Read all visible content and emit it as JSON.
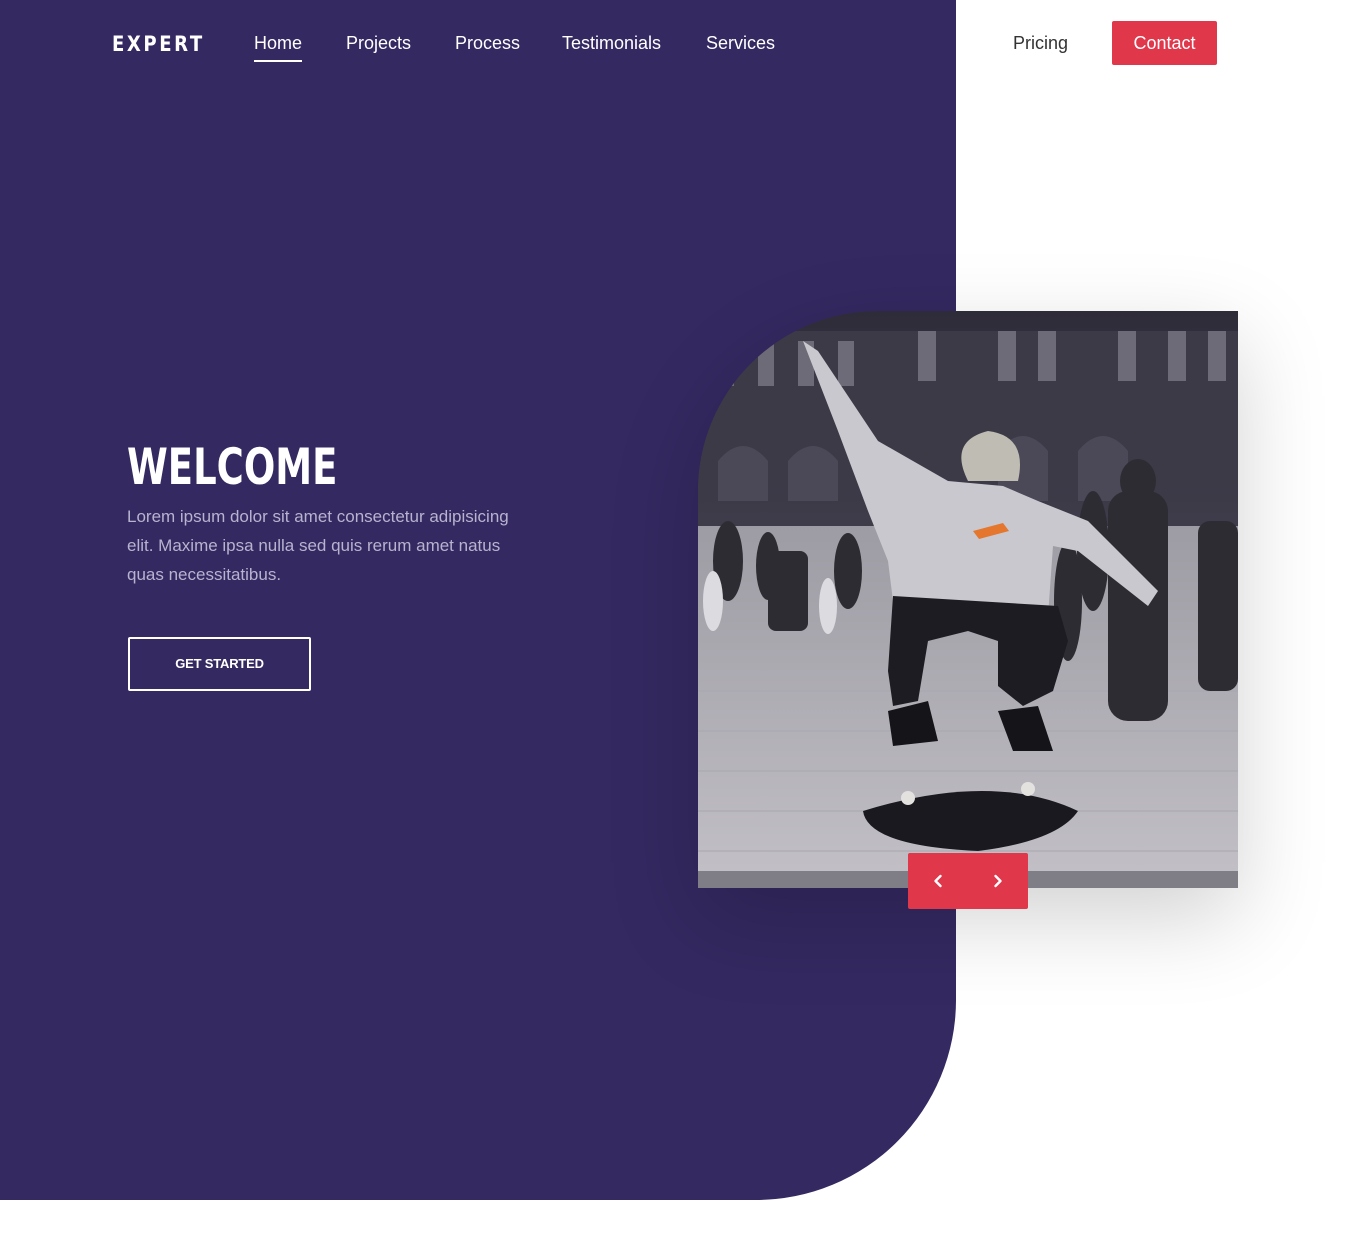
{
  "brand": {
    "logo_text": "EXPERT",
    "accent_color": "#e0374b",
    "hero_color": "#342961"
  },
  "nav": {
    "links": [
      {
        "label": "Home",
        "active": true
      },
      {
        "label": "Projects"
      },
      {
        "label": "Process"
      },
      {
        "label": "Testimonials"
      },
      {
        "label": "Services"
      }
    ],
    "pricing_label": "Pricing",
    "contact_label": "Contact"
  },
  "hero": {
    "title": "WELCOME",
    "lead": "Lorem ipsum dolor sit amet consectetur adipisicing elit. Maxime ipsa nulla sed quis rerum amet natus quas necessitatibus.",
    "cta_label": "GET STARTED"
  },
  "slider": {
    "prev_icon": "chevron-left-icon",
    "next_icon": "chevron-right-icon"
  }
}
